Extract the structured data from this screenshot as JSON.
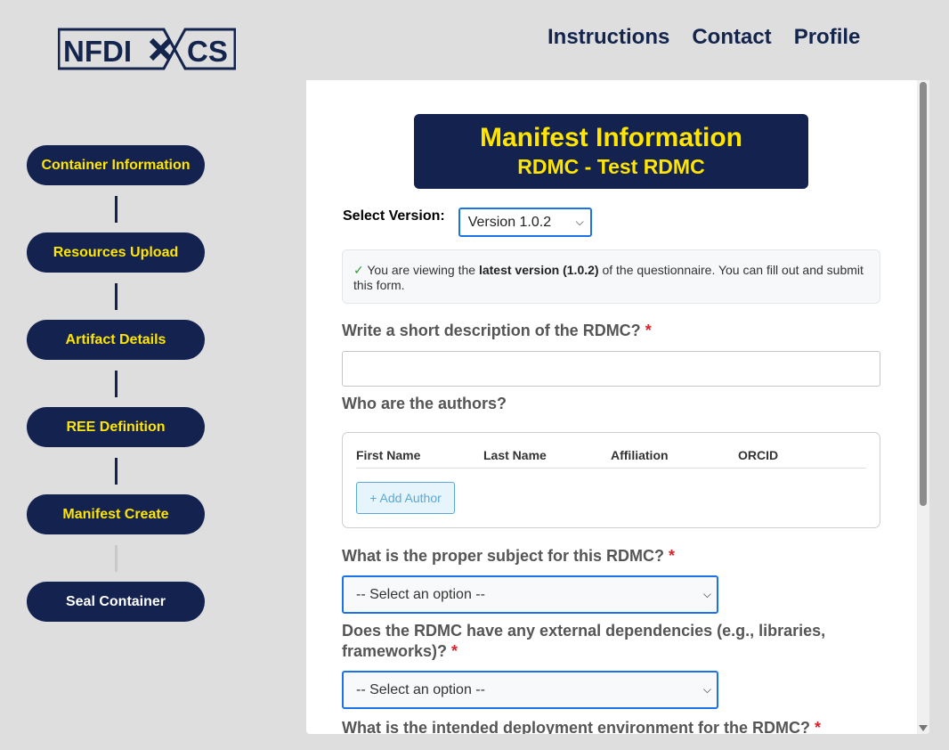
{
  "logo": {
    "text_left": "NFDI",
    "text_right": "CS"
  },
  "nav": {
    "instructions": "Instructions",
    "contact": "Contact",
    "profile": "Profile"
  },
  "steps": [
    {
      "label": "Container Information",
      "active": true
    },
    {
      "label": "Resources Upload",
      "active": true
    },
    {
      "label": "Artifact Details",
      "active": true
    },
    {
      "label": "REE Definition",
      "active": true
    },
    {
      "label": "Manifest Create",
      "active": true
    },
    {
      "label": "Seal Container",
      "active": false
    }
  ],
  "header": {
    "title": "Manifest Information",
    "subtitle": "RDMC - Test RDMC"
  },
  "version": {
    "label": "Select Version:",
    "selected": "Version 1.0.2"
  },
  "notice": {
    "check": "✓",
    "prefix": " You are viewing the ",
    "bold": "latest version (1.0.2)",
    "suffix": " of the questionnaire. You can fill out and submit this form."
  },
  "questions": {
    "description": {
      "label": "Write a short description of the RDMC?",
      "required": "*",
      "value": ""
    },
    "authors": {
      "label": "Who are the authors?",
      "columns": [
        "First Name",
        "Last Name",
        "Affiliation",
        "ORCID"
      ],
      "add_button": "+ Add Author"
    },
    "subject": {
      "label": "What is the proper subject for this RDMC?",
      "required": "*",
      "selected": "-- Select an option --"
    },
    "dependencies": {
      "label": "Does the RDMC have any external dependencies (e.g., libraries, frameworks)?",
      "required": "*",
      "selected": "-- Select an option --"
    },
    "deployment": {
      "label": "What is the intended deployment environment for the RDMC?",
      "required": "*"
    }
  },
  "colors": {
    "navy": "#13224f",
    "accent_yellow": "#ffe500",
    "focus_blue": "#1a73e8",
    "required_red": "#d9222a",
    "background": "#dedede"
  }
}
